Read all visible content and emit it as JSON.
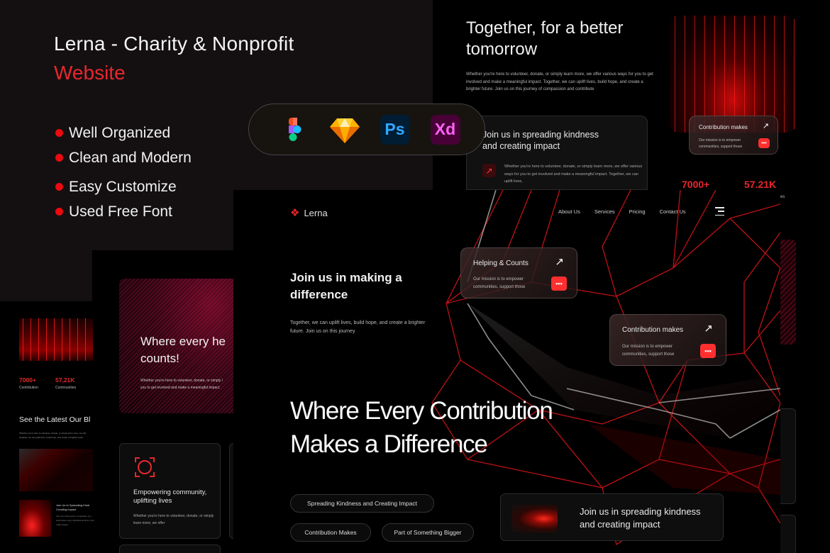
{
  "promo": {
    "title": "Lerna - Charity & Nonprofit",
    "subtitle": "Website",
    "features": [
      "Well Organized",
      "Clean and Modern",
      "Easy Customize",
      "Used Free Font"
    ],
    "tools": [
      {
        "name": "figma-icon",
        "label": ""
      },
      {
        "name": "sketch-icon",
        "label": ""
      },
      {
        "name": "photoshop-icon",
        "label": "Ps"
      },
      {
        "name": "xd-icon",
        "label": "Xd"
      }
    ],
    "accent_color": "#e8272c"
  },
  "top_right": {
    "title_line1": "Together, for a better",
    "title_line2": "tomorrow",
    "description": "Whether you're here to volunteer, donate, or simply learn more, we offer various ways for you to get involved and make a meaningful impact. Together, we can uplift lives, build hope, and create a brighter future. Join us on this journey of compassion and contribute",
    "join_card": {
      "title_line1": "Join us in spreading kindness",
      "title_line2": "and creating impact",
      "arrow": "↗",
      "description": "Whether you're here to volunteer, donate, or simply learn more, we offer various ways for you to get involved and make a meaningful impact. Together, we can uplift lives,"
    },
    "contribution_card": {
      "title": "Contribution makes",
      "arrow": "↗",
      "description": "Our mission is to empower communities, support those",
      "dots": "•••"
    },
    "stats": [
      {
        "value": "7000+"
      },
      {
        "value": "57.21K"
      }
    ],
    "stat_partial_label": "es"
  },
  "hero": {
    "logo_mark": "❖",
    "logo_text": "Lerna",
    "nav": [
      "About Us",
      "Services",
      "Pricing",
      "Contact Us"
    ],
    "subheading_line1": "Join us in making a",
    "subheading_line2": "difference",
    "paragraph": "Together, we can uplift lives, build hope, and create a brighter future. Join us on this journey",
    "helping_card": {
      "title": "Helping & Counts",
      "arrow": "↗",
      "description": "Our mission is to empower communities, support those",
      "dots": "•••"
    },
    "contribution_card": {
      "title": "Contribution makes",
      "arrow": "↗",
      "description": "Our mission is to empower communities, support those",
      "dots": "•••"
    },
    "headline_line1": "Where Every Contribution",
    "headline_line2": "Makes a Difference",
    "chips": [
      "Spreading Kindness and Creating Impact",
      "Contribution Makes",
      "Part of Something Bigger"
    ],
    "join_card": {
      "title_line1": "Join us in spreading kindness",
      "title_line2": "and creating impact"
    }
  },
  "mobile": {
    "stats": [
      {
        "value": "7000+",
        "label": "Contribution"
      },
      {
        "value": "57,21K",
        "label": "Communities"
      }
    ],
    "blog_title": "See the Latest Our Bl",
    "blog_desc_line1": "Whether you're here to volunteer, donate, or simply learn more, we offe",
    "blog_desc_line2": "Together, we can uplift lives, build hope, and create a brighter future.",
    "post_title": "Join Us In Spreading Kindr Creating Impact",
    "post_desc": "Join us on this journey. compassion to a world where every individual ha thrive. Let's make change"
  },
  "tablet": {
    "hero_title_line1": "Where every he",
    "hero_title_line2": "counts!",
    "hero_desc_line1": "Whether you're here to volunteer, donate, or simply l",
    "hero_desc_line2": "you to get involved and make a meaningful impact.",
    "card_title": "Empowering community, uplifting lives",
    "card_desc": "Whether you're here to volunteer, donate, or simply learn more, we offer"
  }
}
